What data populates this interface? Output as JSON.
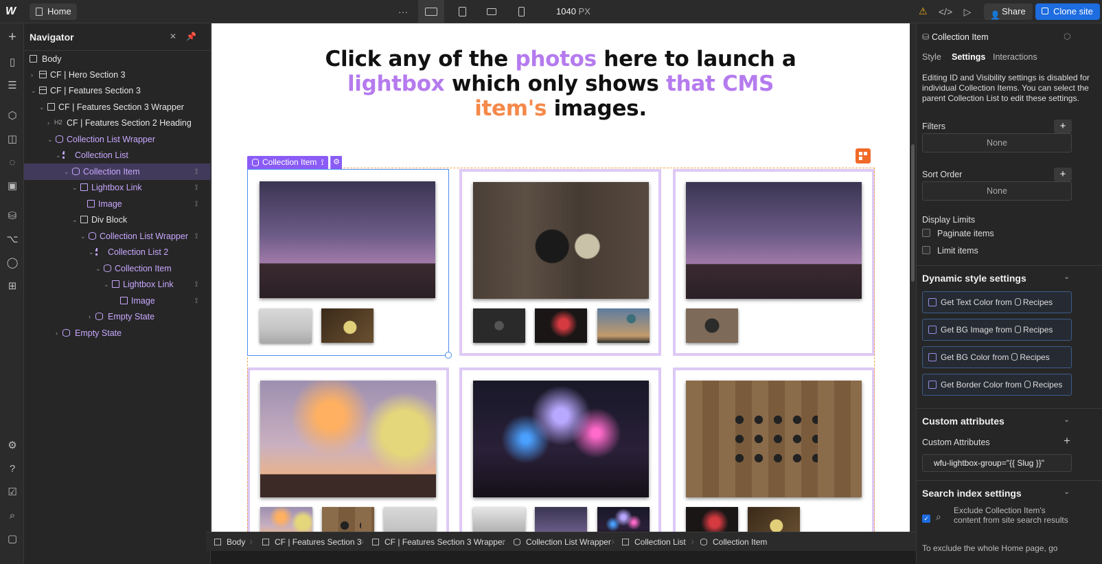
{
  "topbar": {
    "logo": "W",
    "page_name": "Home",
    "more": "···",
    "width_value": "1040",
    "width_unit": "PX",
    "share_label": "Share",
    "clone_label": "Clone site"
  },
  "navigator": {
    "title": "Navigator",
    "items": [
      {
        "label": "Body"
      },
      {
        "label": "CF | Hero Section 3"
      },
      {
        "label": "CF | Features Section 3"
      },
      {
        "label": "CF | Features Section 3 Wrapper"
      },
      {
        "label": "CF | Features Section 2 Heading",
        "tag": "H2"
      },
      {
        "label": "Collection List Wrapper"
      },
      {
        "label": "Collection List"
      },
      {
        "label": "Collection Item"
      },
      {
        "label": "Lightbox Link"
      },
      {
        "label": "Image"
      },
      {
        "label": "Div Block"
      },
      {
        "label": "Collection List Wrapper"
      },
      {
        "label": "Collection List 2"
      },
      {
        "label": "Collection Item"
      },
      {
        "label": "Lightbox Link"
      },
      {
        "label": "Image"
      },
      {
        "label": "Empty State"
      },
      {
        "label": "Empty State"
      }
    ]
  },
  "canvas": {
    "headline": {
      "p1": "Click any of the ",
      "p2": "photos",
      "p3": " here to launch a ",
      "p4": "lightbox",
      "p5": " which only shows ",
      "p6": "that CMS ",
      "p7": "item's",
      "p8": " images."
    },
    "selected_tag": "Collection Item"
  },
  "breadcrumbs": [
    "Body",
    "CF | Features Section 3",
    "CF | Features Section 3 Wrapper",
    "Collection List Wrapper",
    "Collection List",
    "Collection Item"
  ],
  "right_panel": {
    "element_name": "Collection Item",
    "tabs": [
      "Style",
      "Settings",
      "Interactions"
    ],
    "active_tab": "Settings",
    "note": "Editing ID and Visibility settings is disabled for individual Collection Items. You can select the parent Collection List to edit these settings.",
    "filters_label": "Filters",
    "filters_value": "None",
    "sort_label": "Sort Order",
    "sort_value": "None",
    "display_limits_label": "Display Limits",
    "paginate_label": "Paginate items",
    "limit_label": "Limit items",
    "dynamic_title": "Dynamic style settings",
    "dynamic_items": [
      {
        "pre": "Get Text Color from",
        "src": "Recipes"
      },
      {
        "pre": "Get BG Image from",
        "src": "Recipes"
      },
      {
        "pre": "Get BG Color from",
        "src": "Recipes"
      },
      {
        "pre": "Get Border Color from",
        "src": "Recipes"
      }
    ],
    "custom_attr_title": "Custom attributes",
    "custom_attr_label": "Custom Attributes",
    "custom_attr_value": "wfu-lightbox-group=\"{{ Slug }}\"",
    "search_title": "Search index settings",
    "search_text": "Exclude Collection Item's content from site search results",
    "search_more": "To exclude the whole Home page, go"
  },
  "colors": {
    "accent_purple": "#8a5cf5",
    "brand_blue": "#1d6ce0",
    "warning": "#e6a817"
  }
}
